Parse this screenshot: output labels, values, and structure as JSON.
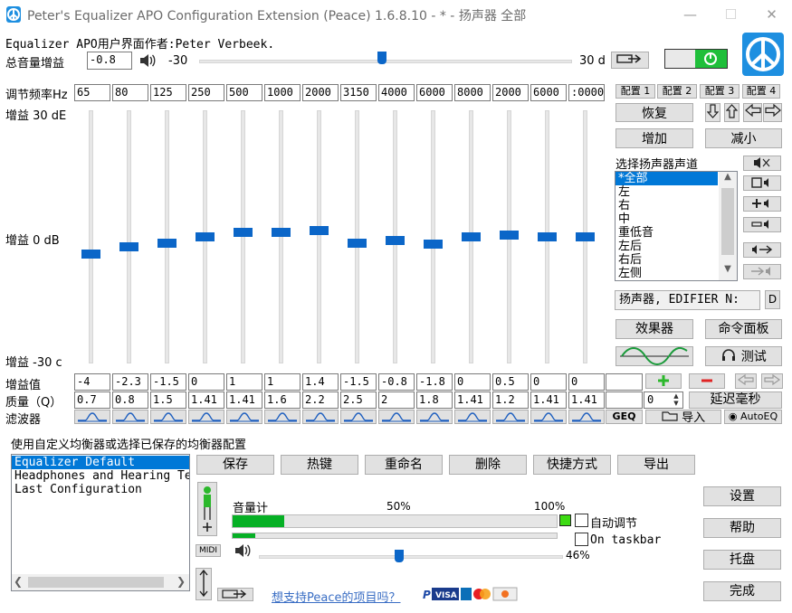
{
  "window": {
    "title": "Peter's Equalizer APO Configuration Extension (Peace) 1.6.8.10 - * - 扬声器 全部",
    "minimize_glyph": "—",
    "maximize_glyph": "☐",
    "close_glyph": "✕"
  },
  "header": {
    "author_text": "Equalizer APO用户界面作者:Peter Verbeek.",
    "preamp_label": "总音量增益",
    "preamp_value": "-0.8",
    "preamp_min": "-30",
    "preamp_max": "30 d",
    "preamp_level_fraction": 0.49,
    "power_color": "#1fbf3a"
  },
  "eq": {
    "freq_label": "调节频率Hz",
    "frequencies": [
      "65",
      "80",
      "125",
      "250",
      "500",
      "1000",
      "2000",
      "3150",
      "4000",
      "6000",
      "8000",
      "2000",
      "6000",
      ":0000"
    ],
    "gain_top_label": "增益 30 dE",
    "gain_mid_label": "增益 0 dB",
    "gain_bottom_label": "增益 -30 c",
    "gain_row_label": "增益值",
    "gains": [
      "-4",
      "-2.3",
      "-1.5",
      "0",
      "1",
      "1",
      "1.4",
      "-1.5",
      "-0.8",
      "-1.8",
      "0",
      "0.5",
      "0",
      "0"
    ],
    "gain_values": [
      -4,
      -2.3,
      -1.5,
      0,
      1,
      1,
      1.4,
      -1.5,
      -0.8,
      -1.8,
      0,
      0.5,
      0,
      0
    ],
    "q_row_label": "质量（Q）",
    "qs": [
      "0.7",
      "0.8",
      "1.5",
      "1.41",
      "1.41",
      "1.6",
      "2.2",
      "2.5",
      "2",
      "1.8",
      "1.41",
      "1.2",
      "1.41",
      "1.41"
    ],
    "filter_row_label": "滤波器",
    "delay_value": "0",
    "delay_label": "延迟毫秒"
  },
  "right_panel": {
    "presets": [
      "配置 1",
      "配置 2",
      "配置 3",
      "配置 4"
    ],
    "restore": "恢复",
    "increase": "增加",
    "decrease": "减小",
    "channel_label": "选择扬声器声道",
    "channels": [
      "*全部",
      "左",
      "右",
      "中",
      "重低音",
      "左后",
      "右后",
      "左侧"
    ],
    "device_select": "扬声器, EDIFIER N:",
    "device_d": "D",
    "effects": "效果器",
    "command_panel": "命令面板",
    "test": "测试",
    "import": "导入",
    "autoeq": "AutoEQ",
    "geq": "GEQ"
  },
  "bottom": {
    "config_label": "使用自定义均衡器或选择已保存的均衡器配置",
    "configs": [
      "Equalizer Default",
      "Headphones and Hearing Te",
      "Last Configuration"
    ],
    "save": "保存",
    "hotkey": "热键",
    "rename": "重命名",
    "delete": "删除",
    "shortcut": "快捷方式",
    "export": "导出",
    "meter_label": "音量计",
    "meter_50": "50%",
    "meter_100": "100%",
    "meter_level_fraction": 0.16,
    "meter2_level_fraction": 0.07,
    "auto_adjust": "自动调节",
    "on_taskbar": "On taskbar",
    "volume_percent": "46%",
    "volume_fraction": 0.46,
    "midi": "MIDI",
    "support_link": "想支持Peace的项目吗？",
    "settings": "设置",
    "help": "帮助",
    "tray": "托盘",
    "done": "完成"
  }
}
